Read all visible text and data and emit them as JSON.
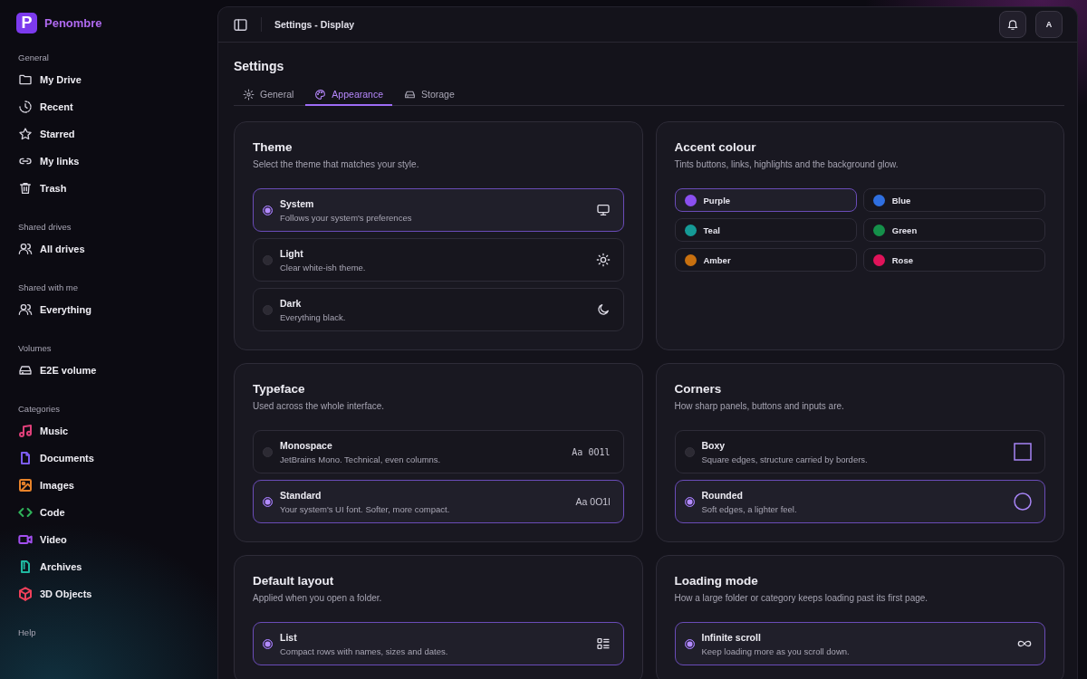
{
  "brand": {
    "logo_letter": "P",
    "name": "Penombre"
  },
  "sidebar": {
    "sections": [
      {
        "heading": "General",
        "items": [
          {
            "label": "My Drive"
          },
          {
            "label": "Recent"
          },
          {
            "label": "Starred"
          },
          {
            "label": "My links"
          },
          {
            "label": "Trash"
          }
        ]
      },
      {
        "heading": "Shared drives",
        "items": [
          {
            "label": "All drives"
          }
        ]
      },
      {
        "heading": "Shared with me",
        "items": [
          {
            "label": "Everything"
          }
        ]
      },
      {
        "heading": "Volumes",
        "items": [
          {
            "label": "E2E volume"
          }
        ]
      },
      {
        "heading": "Categories",
        "items": [
          {
            "label": "Music",
            "color": "#e0407a"
          },
          {
            "label": "Documents",
            "color": "#7c5cf0"
          },
          {
            "label": "Images",
            "color": "#e8832a"
          },
          {
            "label": "Code",
            "color": "#2fb35a"
          },
          {
            "label": "Video",
            "color": "#a34ff0"
          },
          {
            "label": "Archives",
            "color": "#20b8a0"
          },
          {
            "label": "3D Objects",
            "color": "#f0405a"
          }
        ]
      },
      {
        "heading": "Help"
      }
    ]
  },
  "topbar": {
    "title": "Settings - Display",
    "avatar": "A"
  },
  "page_title": "Settings",
  "tabs": [
    {
      "label": "General",
      "selected": false
    },
    {
      "label": "Appearance",
      "selected": true
    },
    {
      "label": "Storage",
      "selected": false
    }
  ],
  "cards": [
    {
      "kind": "options",
      "title": "Theme",
      "subtitle": "Select the theme that matches your style.",
      "options": [
        {
          "label": "System",
          "description": "Follows your system's preferences",
          "selected": true,
          "kind": "icon"
        },
        {
          "label": "Light",
          "description": "Clear white-ish theme.",
          "selected": false,
          "kind": "icon"
        },
        {
          "label": "Dark",
          "description": "Everything black.",
          "selected": false,
          "kind": "icon"
        }
      ]
    },
    {
      "kind": "swatches",
      "title": "Accent colour",
      "subtitle": "Tints buttons, links, highlights and the background glow.",
      "swatches": [
        {
          "label": "Purple",
          "color": "#8b4ff0",
          "selected": true
        },
        {
          "label": "Blue",
          "color": "#2f6fe0",
          "selected": false
        },
        {
          "label": "Teal",
          "color": "#159a96",
          "selected": false
        },
        {
          "label": "Green",
          "color": "#15904a",
          "selected": false
        },
        {
          "label": "Amber",
          "color": "#c8700f",
          "selected": false
        },
        {
          "label": "Rose",
          "color": "#e0135a",
          "selected": false
        }
      ]
    },
    {
      "kind": "options",
      "title": "Typeface",
      "subtitle": "Used across the whole interface.",
      "options": [
        {
          "label": "Monospace",
          "description": "JetBrains Mono. Technical, even columns.",
          "selected": false,
          "kind": "mono",
          "preview": "Aa 0O1l"
        },
        {
          "label": "Standard",
          "description": "Your system's UI font. Softer, more compact.",
          "selected": true,
          "kind": "sans",
          "preview": "Aa 0O1l"
        }
      ]
    },
    {
      "kind": "options",
      "title": "Corners",
      "subtitle": "How sharp panels, buttons and inputs are.",
      "options": [
        {
          "label": "Boxy",
          "description": "Square edges, structure carried by borders.",
          "selected": false,
          "kind": "icon"
        },
        {
          "label": "Rounded",
          "description": "Soft edges, a lighter feel.",
          "selected": true,
          "kind": "icon"
        }
      ]
    },
    {
      "kind": "options",
      "title": "Default layout",
      "subtitle": "Applied when you open a folder.",
      "options": [
        {
          "label": "List",
          "description": "Compact rows with names, sizes and dates.",
          "selected": true,
          "kind": "icon"
        }
      ]
    },
    {
      "kind": "options",
      "title": "Loading mode",
      "subtitle": "How a large folder or category keeps loading past its first page.",
      "options": [
        {
          "label": "Infinite scroll",
          "description": "Keep loading more as you scroll down.",
          "selected": true,
          "kind": "icon"
        }
      ]
    }
  ]
}
